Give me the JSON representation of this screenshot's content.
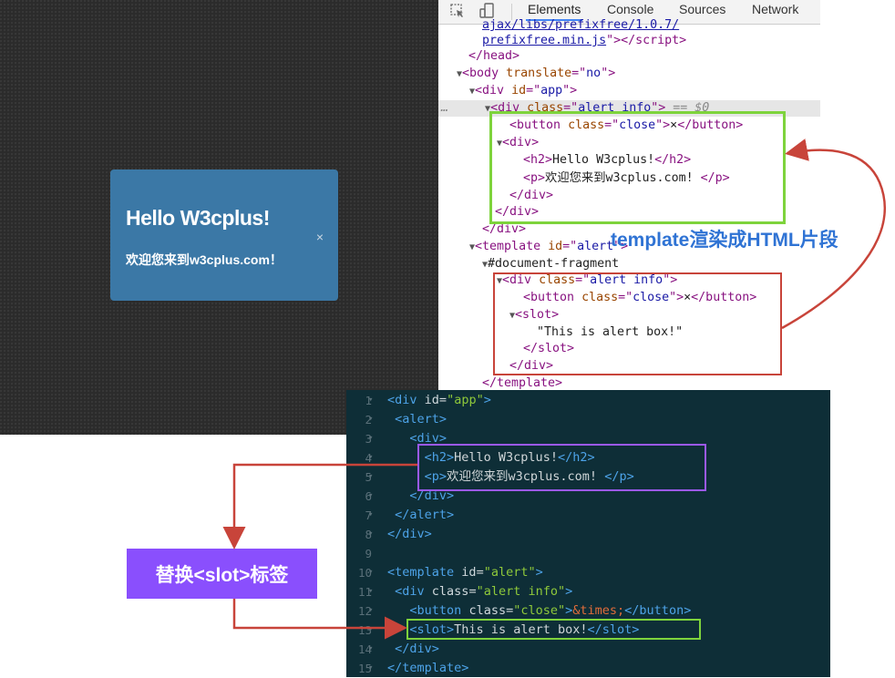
{
  "preview": {
    "alert": {
      "title": "Hello W3cplus!",
      "text": "欢迎您来到w3cplus.com！",
      "close": "×"
    }
  },
  "devtools": {
    "tabs": [
      "Elements",
      "Console",
      "Sources",
      "Network"
    ],
    "active_tab": "Elements",
    "selected_suffix": "== $0",
    "dom": {
      "l0_src": "ajax/libs/prefixfree/1.0.7/",
      "l1_src": "prefixfree.min.js",
      "head_close": "</head>",
      "body_tag": "body",
      "body_attr": "translate",
      "body_val": "no",
      "app_tag": "div",
      "app_attr": "id",
      "app_val": "app",
      "alert_tag": "div",
      "alert_attr": "class",
      "alert_val": "alert info",
      "button_tag": "button",
      "button_attr": "class",
      "button_val": "close",
      "button_text": "×",
      "inner_div": "div",
      "h2_text": "Hello W3cplus!",
      "p_text": "欢迎您来到w3cplus.com! ",
      "template_attr": "id",
      "template_val": "alert",
      "fragment": "#document-fragment",
      "slot_tag": "slot",
      "slot_text": "\"This is alert box!\""
    }
  },
  "annotations": {
    "template_render": "template渲染成HTML片段",
    "replace_slot": "替换<slot>标签"
  },
  "editor": {
    "line_numbers": [
      "1",
      "2",
      "3",
      "4",
      "5",
      "6",
      "7",
      "8",
      "9",
      "10",
      "11",
      "12",
      "13",
      "14",
      "15"
    ],
    "h2_text": "Hello W3cplus!",
    "p_text": "欢迎您来到w3cplus.com! ",
    "slot_text": "This is alert box!",
    "entity": "&times;"
  },
  "colors": {
    "alert_bg": "#3b78a6",
    "green_box": "#7ed33c",
    "red_box": "#c8443a",
    "purple_box": "#9b59f0",
    "annotation_blue": "#2f73d4",
    "replace_label_bg": "#8a4ffd",
    "editor_bg": "#0e2e37"
  }
}
